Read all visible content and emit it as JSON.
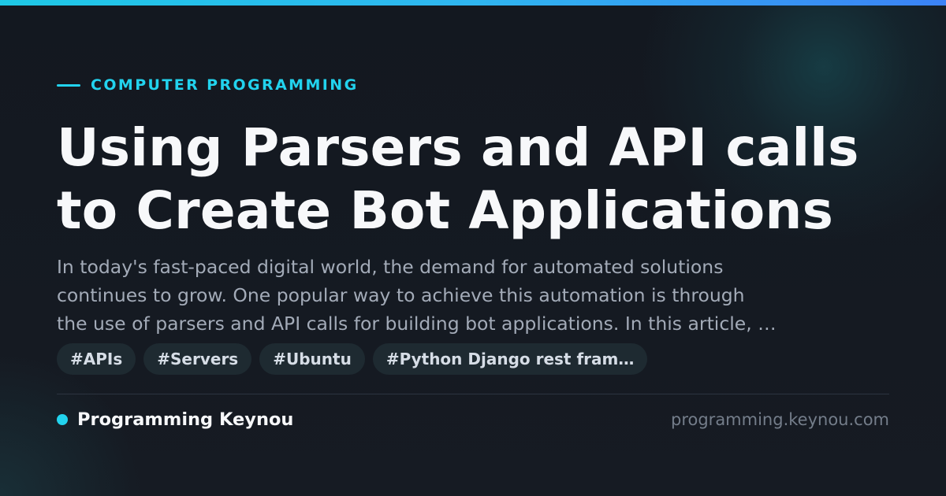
{
  "category": "COMPUTER PROGRAMMING",
  "title": "Using Parsers and API calls to Create Bot Applications",
  "excerpt": "In today's fast-paced digital world, the demand for automated solutions\ncontinues to grow. One popular way to achieve this automation is through\nthe use of parsers and API calls for building bot applications. In this article, …",
  "tags": [
    "#APIs",
    "#Servers",
    "#Ubuntu",
    "#Python Django rest fram…"
  ],
  "brand": {
    "name": "Programming Keynou",
    "domain": "programming.keynou.com"
  },
  "colors": {
    "accent": "#22d3ee",
    "background": "#151a22",
    "title": "#f7f8fa",
    "excerpt": "#a3abb8",
    "tag_background": "#1e2a31",
    "domain": "#747d8a"
  }
}
